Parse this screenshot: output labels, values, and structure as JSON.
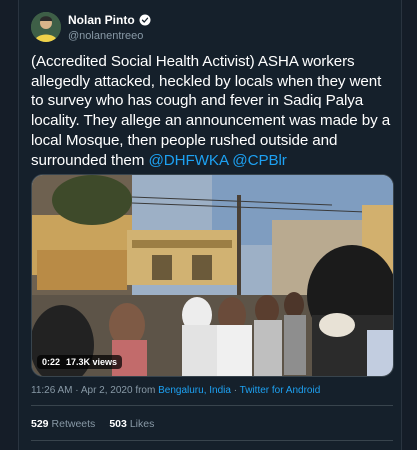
{
  "tweet": {
    "author_name": "Nolan Pinto",
    "author_handle": "@nolanentreeo",
    "text_main": "(Accredited Social Health Activist) ASHA workers allegedly attacked, heckled by locals when they went to survey who has cough and fever in Sadiq Palya locality. They allege an announcement was made by a local Mosque, then people rushed outside and surrounded them ",
    "mention_1": "@DHFWKA",
    "mention_2": "@CPBlr",
    "video_time": "0:22",
    "video_views": "17.3K views",
    "timestamp": "11:26 AM · Apr 2, 2020 from ",
    "location": "Bengaluru, India",
    "separator": " · ",
    "source": "Twitter for Android",
    "retweets_count": "529",
    "retweets_label": "Retweets",
    "likes_count": "503",
    "likes_label": "Likes"
  },
  "icons": {
    "verified": "verified-badge-icon"
  },
  "colors": {
    "background": "#15202b",
    "link": "#1da1f2",
    "secondary_text": "#8899a6"
  }
}
